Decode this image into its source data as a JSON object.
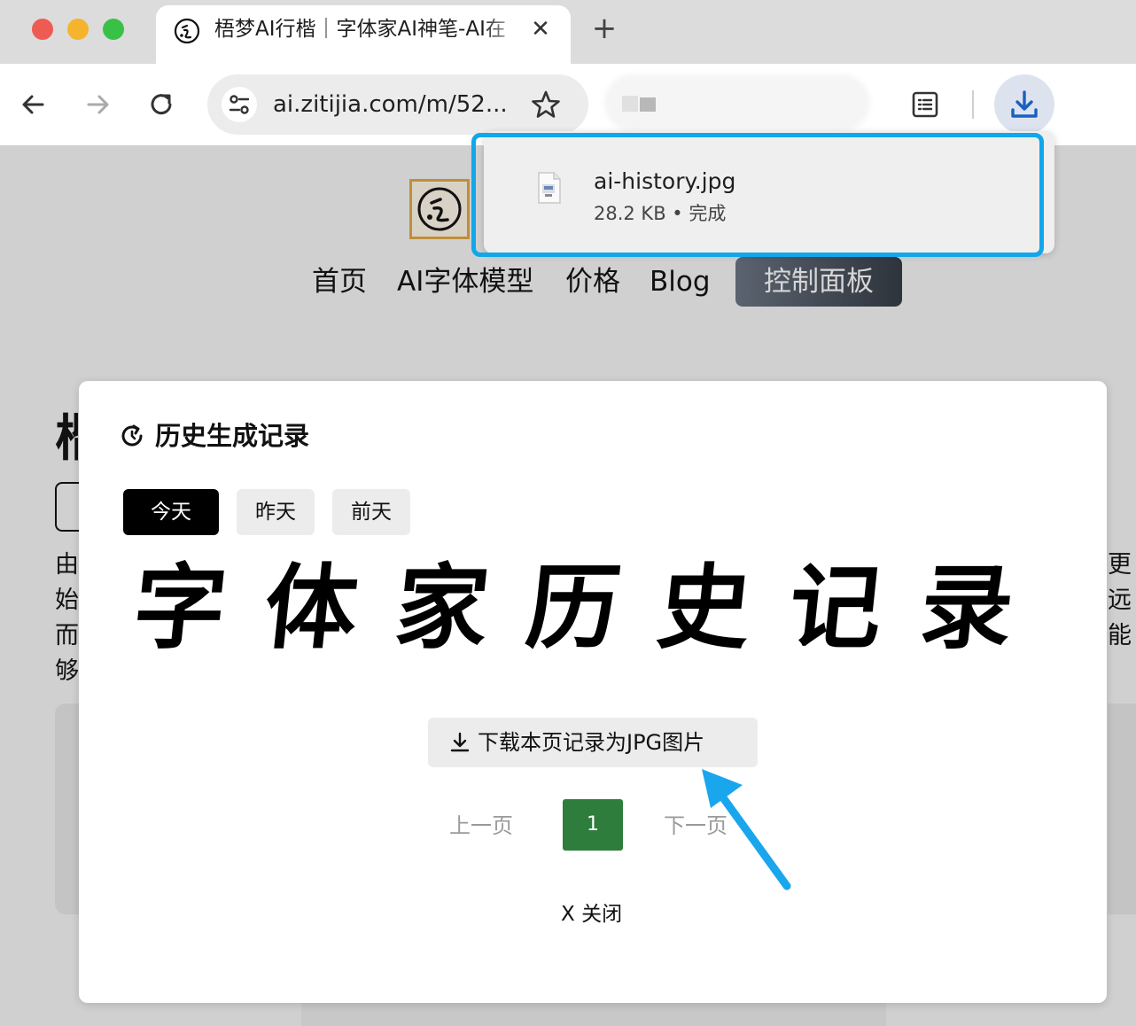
{
  "browser": {
    "tab": {
      "title": "梧梦AI行楷｜字体家AI神笔-AI在",
      "close_glyph": "✕"
    },
    "new_tab_glyph": "+",
    "address_bar": {
      "url": "ai.zitijia.com/m/52..."
    }
  },
  "downloads": {
    "items": [
      {
        "filename": "ai-history.jpg",
        "meta": "28.2 KB • 完成"
      }
    ]
  },
  "site": {
    "nav": [
      "首页",
      "AI字体模型",
      "价格",
      "Blog"
    ],
    "dashboard_button": "控制面板",
    "background": {
      "heading_partial": "楷",
      "left_lines": [
        "由",
        "始",
        "而",
        "够"
      ],
      "right_lines": [
        "更",
        "远",
        "能"
      ]
    }
  },
  "modal": {
    "title": "历史生成记录",
    "day_tabs": [
      {
        "label": "今天",
        "active": true
      },
      {
        "label": "昨天",
        "active": false
      },
      {
        "label": "前天",
        "active": false
      }
    ],
    "calligraphy_text": "字体家历史记录",
    "download_button": "下载本页记录为JPG图片",
    "pagination": {
      "prev": "上一页",
      "current": "1",
      "next": "下一页"
    },
    "close": "X 关闭"
  },
  "colors": {
    "highlight": "#12a6ea",
    "pager_active": "#2e7d3c",
    "download_accent": "#1a5fc2"
  },
  "icons": {
    "tab_favicon": "zitijia-logo-icon",
    "back": "arrow-left-icon",
    "forward": "arrow-right-icon",
    "reload": "reload-icon",
    "site_settings": "tune-icon",
    "bookmark": "star-icon",
    "reading_list": "reading-list-icon",
    "downloads": "download-icon",
    "history": "history-icon",
    "file": "image-file-icon"
  }
}
